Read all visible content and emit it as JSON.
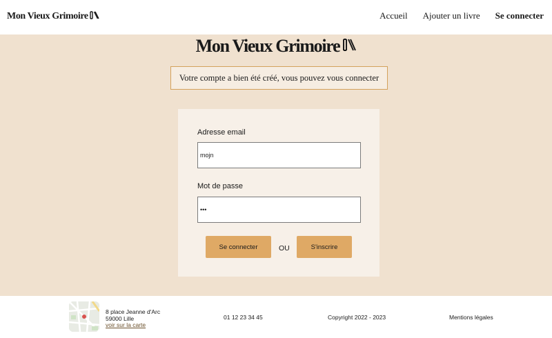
{
  "header": {
    "logo_text": "Mon Vieux Grimoire",
    "nav": {
      "home": "Accueil",
      "add_book": "Ajouter un livre",
      "login": "Se connecter"
    }
  },
  "main": {
    "title": "Mon Vieux Grimoire",
    "alert": "Votre compte a bien été créé, vous pouvez vous connecter",
    "form": {
      "email_label": "Adresse email",
      "email_value": "mojn",
      "password_label": "Mot de passe",
      "password_value": "•••",
      "login_button": "Se connecter",
      "or_text": "OU",
      "signup_button": "S'inscrire"
    }
  },
  "footer": {
    "address_line1": "8 place Jeanne d'Arc",
    "address_line2": "59000 Lille",
    "map_link": "voir sur la carte",
    "phone": "01 12 23 34 45",
    "copyright": "Copyright 2022 - 2023",
    "legal": "Mentions légales"
  },
  "colors": {
    "main_bg": "#f0e1cf",
    "card_bg": "#f7f0e8",
    "accent": "#dfa965",
    "alert_border": "#d3a15b"
  },
  "icons": {
    "logo": "books-icon",
    "map": "map-thumbnail"
  }
}
